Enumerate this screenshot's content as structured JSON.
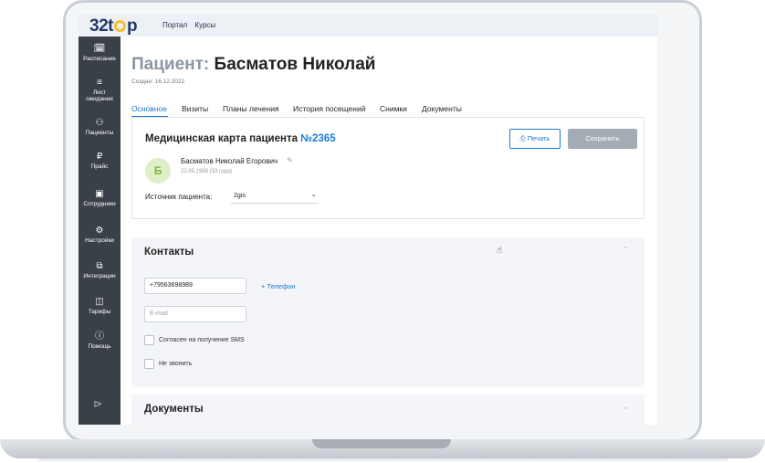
{
  "logo": {
    "text_left": "32t",
    "text_right": "p"
  },
  "top_links": [
    "Портал",
    "Курсы"
  ],
  "sidebar": {
    "items": [
      {
        "icon": "calendar-icon",
        "glyph": "🗓",
        "label": "Расписание"
      },
      {
        "icon": "list-edit-icon",
        "glyph": "≡",
        "label": "Лист ожидания"
      },
      {
        "icon": "person-icon",
        "glyph": "⚇",
        "label": "Пациенты"
      },
      {
        "icon": "ruble-icon",
        "glyph": "₽",
        "label": "Прайс"
      },
      {
        "icon": "briefcase-icon",
        "glyph": "▣",
        "label": "Сотрудники"
      },
      {
        "icon": "gear-icon",
        "glyph": "⚙",
        "label": "Настройки"
      },
      {
        "icon": "puzzle-icon",
        "glyph": "⧉",
        "label": "Интеграции"
      },
      {
        "icon": "wallet-icon",
        "glyph": "◫",
        "label": "Тарифы"
      },
      {
        "icon": "info-icon",
        "glyph": "ⓘ",
        "label": "Помощь"
      }
    ],
    "collapse_glyph": "⊳"
  },
  "page": {
    "title_label": "Пациент:",
    "title_name": "Басматов Николай",
    "created": "Создан: 16.12.2022"
  },
  "tabs": [
    {
      "label": "Основное",
      "active": true
    },
    {
      "label": "Визиты",
      "active": false
    },
    {
      "label": "Планы лечения",
      "active": false
    },
    {
      "label": "История посещений",
      "active": false
    },
    {
      "label": "Снимки",
      "active": false
    },
    {
      "label": "Документы",
      "active": false
    }
  ],
  "card": {
    "title": "Медицинская карта пациента",
    "number": "№2365",
    "print_label": "Печать",
    "save_label": "Сохранить",
    "avatar_letter": "Б",
    "patient_full_name": "Басматов Николай Егорович",
    "dob": "22.05.1989 (33 года)",
    "source_label": "Источник пациента:",
    "source_value": "2gis"
  },
  "contacts": {
    "title": "Контакты",
    "phone_value": "+79563698989",
    "add_phone": "+ Телефон",
    "email_placeholder": "E-mail",
    "sms_consent": "Согласен на получение SMS",
    "no_call": "Не звонить"
  },
  "documents": {
    "title": "Документы"
  },
  "colors": {
    "accent": "#1a7bd1",
    "sidebar": "#3a4048",
    "logo": "#263868",
    "logo_ring": "#f2c230"
  }
}
